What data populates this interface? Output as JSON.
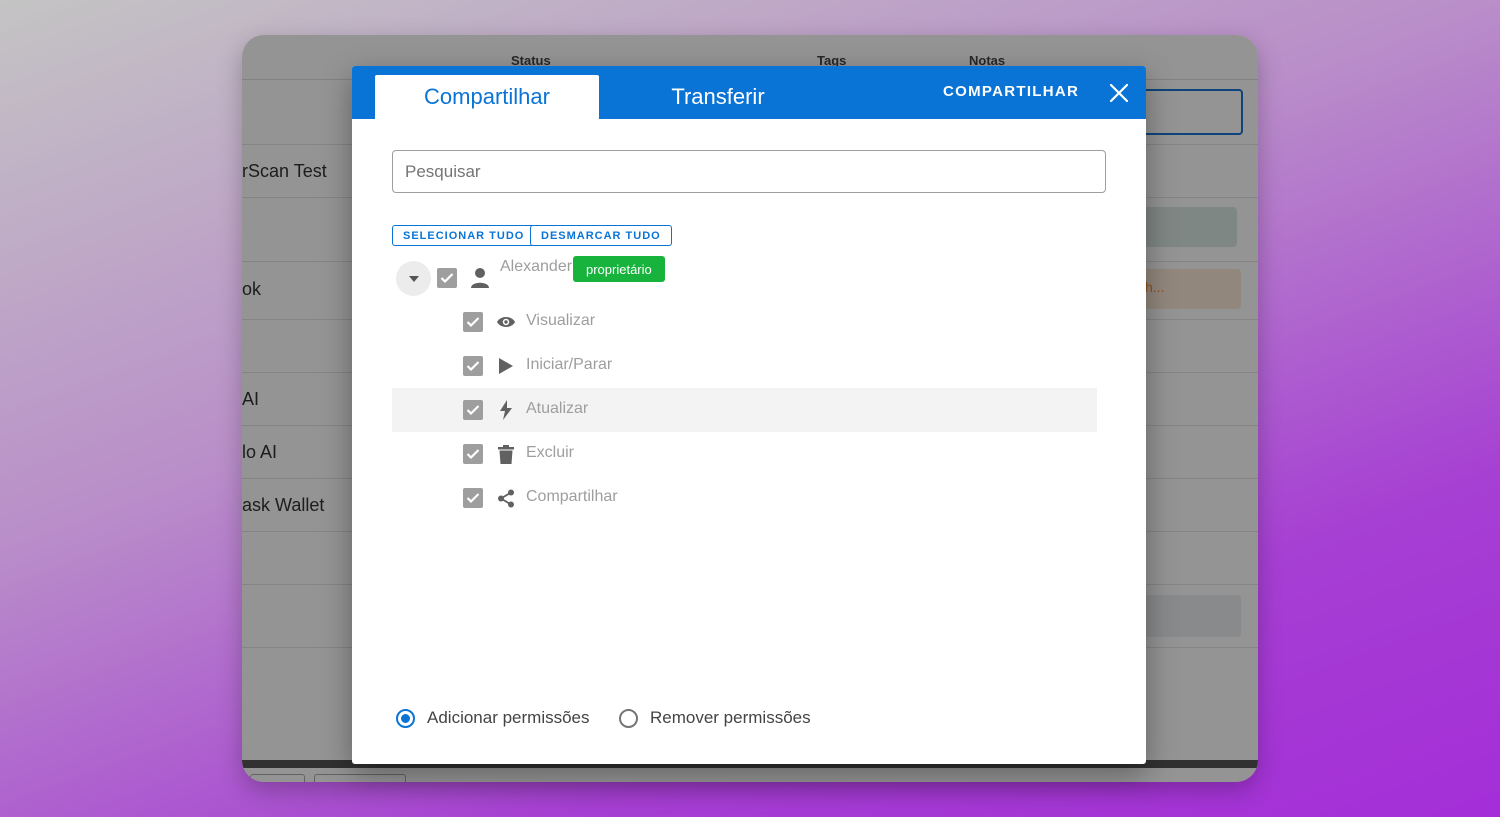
{
  "background_app": {
    "columns": [
      "Status",
      "Tags",
      "Notas"
    ],
    "rows": [
      "rScan Test",
      "ok",
      "AI",
      "lo AI",
      "ask Wallet"
    ],
    "orange_text": "h..."
  },
  "modal": {
    "tabs": [
      "Compartilhar",
      "Transferir"
    ],
    "active_tab": "Compartilhar",
    "header_action": "COMPARTILHAR",
    "close_icon": "close-icon",
    "search": {
      "placeholder": "Pesquisar",
      "value": ""
    },
    "select_all": "SELECIONAR TUDO",
    "deselect_all": "DESMARCAR TUDO",
    "user": {
      "name": "Alexander",
      "badge": "proprietário",
      "checked": true
    },
    "permissions": [
      {
        "label": "Visualizar",
        "icon": "eye-icon",
        "checked": true
      },
      {
        "label": "Iniciar/Parar",
        "icon": "play-icon",
        "checked": true
      },
      {
        "label": "Atualizar",
        "icon": "bolt-icon",
        "checked": true
      },
      {
        "label": "Excluir",
        "icon": "trash-icon",
        "checked": true
      },
      {
        "label": "Compartilhar",
        "icon": "share-icon",
        "checked": true
      }
    ],
    "radio_options": [
      {
        "label": "Adicionar permissões",
        "checked": true
      },
      {
        "label": "Remover permissões",
        "checked": false
      }
    ]
  },
  "colors": {
    "primary": "#0a74d6",
    "badge_green": "#17b33c",
    "checkbox_gray": "#9e9e9e"
  }
}
